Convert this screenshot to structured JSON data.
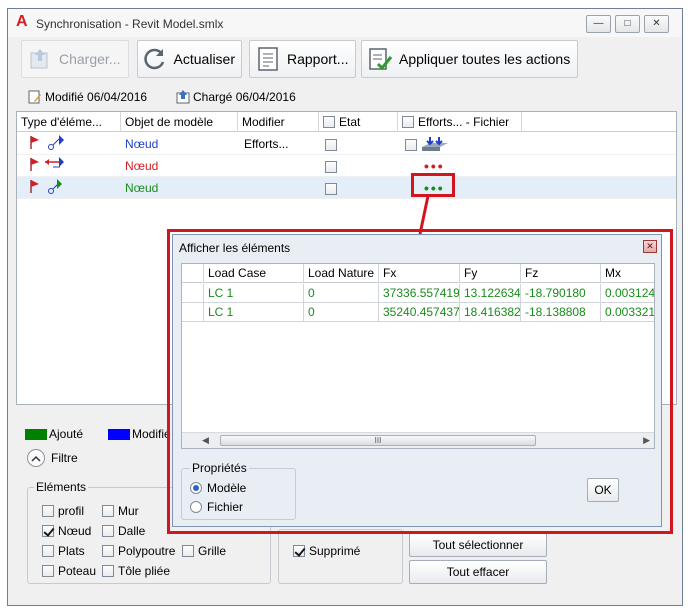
{
  "window": {
    "title": "Synchronisation - Revit Model.smlx",
    "app_logo": "A",
    "controls": [
      "minimize",
      "maximize",
      "close"
    ]
  },
  "toolbar": {
    "charger_label": "Charger...",
    "actualiser_label": "Actualiser",
    "rapport_label": "Rapport...",
    "appliquer_label": "Appliquer toutes les actions"
  },
  "info": {
    "modified": "Modifié 06/04/2016",
    "loaded": "Chargé 06/04/2016"
  },
  "grid": {
    "columns": [
      "Type d'éléme...",
      "Objet de modèle",
      "Modifier",
      "Etat",
      "Efforts... - Fichier"
    ],
    "rows": [
      {
        "object": "Nœud",
        "modifier": "Efforts...",
        "color": "#1f3fc8",
        "dots_color": ""
      },
      {
        "object": "Nœud",
        "modifier": "",
        "color": "#d21f26",
        "dots_color": "#d21f26"
      },
      {
        "object": "Nœud",
        "modifier": "",
        "color": "#1a8c1a",
        "dots_color": "#1a8c1a"
      }
    ],
    "dots": "•••"
  },
  "legend": {
    "added_label": "Ajouté",
    "added_color": "#008000",
    "modified_label": "Modifié",
    "modified_color": "#0000ff"
  },
  "filter": {
    "label": "Filtre",
    "elements_title": "Eléments",
    "items": [
      {
        "label": "profil",
        "checked": false
      },
      {
        "label": "Mur",
        "checked": false
      },
      {
        "label": "Nœud",
        "checked": true
      },
      {
        "label": "Dalle",
        "checked": false
      },
      {
        "label": "Plats",
        "checked": false
      },
      {
        "label": "Polypoutre",
        "checked": false
      },
      {
        "label": "Grille",
        "checked": false
      },
      {
        "label": "Poteau",
        "checked": false
      },
      {
        "label": "Tôle pliée",
        "checked": false
      }
    ],
    "supprime_label": "Supprimé",
    "select_all": "Tout sélectionner",
    "clear_all": "Tout effacer"
  },
  "popup": {
    "title": "Afficher les éléments",
    "columns": [
      "Load Case",
      "Load Nature",
      "Fx",
      "Fy",
      "Fz",
      "Mx"
    ],
    "rows": [
      [
        "LC 1",
        "0",
        "37336.557419",
        "13.122634",
        "-18.790180",
        "0.003124"
      ],
      [
        "LC 1",
        "0",
        "35240.457437",
        "18.416382",
        "-18.138808",
        "0.003321"
      ]
    ],
    "scroll_thumb": "III",
    "properties_title": "Propriétés",
    "radio_model": "Modèle",
    "radio_file": "Fichier",
    "ok_label": "OK"
  }
}
